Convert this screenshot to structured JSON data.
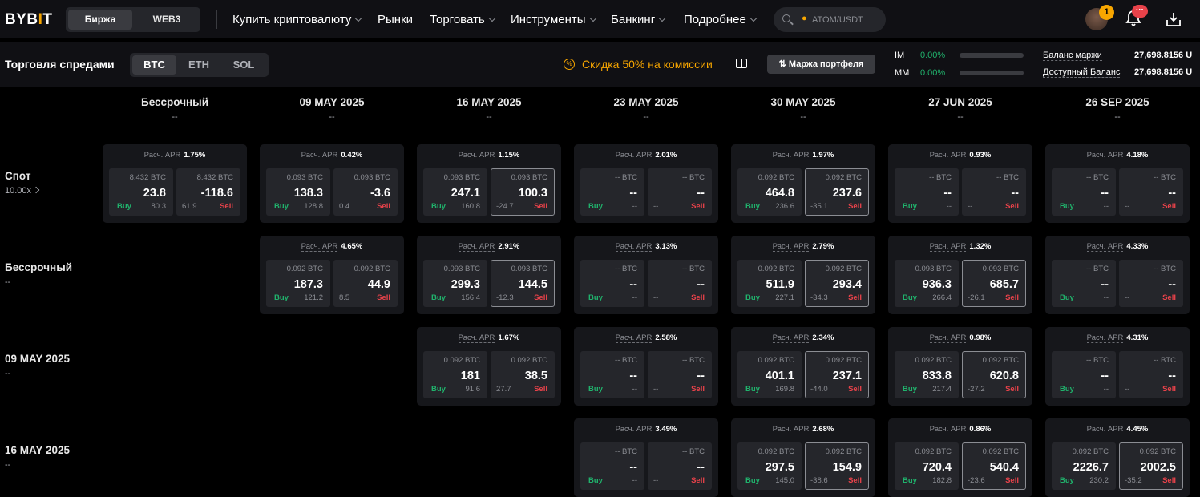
{
  "header": {
    "logo": {
      "pre": "BYB",
      "mid": "I",
      "post": "T"
    },
    "switch": {
      "exchange": "Биржа",
      "web3": "WEB3"
    },
    "nav": [
      "Купить криптовалюту",
      "Рынки",
      "Торговать",
      "Инструменты",
      "Банкинг",
      "Подробнее"
    ],
    "search_placeholder": "ATOM/USDT",
    "avatar_badge": "1",
    "bell_badge": "···"
  },
  "subbar": {
    "title": "Торговля спредами",
    "coins": [
      "BTC",
      "ETH",
      "SOL"
    ],
    "active_coin": "BTC",
    "promo": "Скидка 50% на комиссии",
    "portfolio_margin": "Маржа портфеля",
    "im_label": "IM",
    "im_value": "0.00%",
    "mm_label": "MM",
    "mm_value": "0.00%",
    "margin_balance_label": "Баланс маржи",
    "margin_balance_value": "27,698.8156 U",
    "available_label": "Доступный Баланс",
    "available_value": "27,698.8156 U"
  },
  "colors": {
    "accent": "#f7a600",
    "buy": "#20b26c",
    "sell": "#e8424a",
    "card": "#16171b",
    "cell": "#25262b"
  },
  "labels": {
    "apr": "Расч. APR",
    "buy": "Buy",
    "sell": "Sell",
    "unit": "BTC",
    "dash": "--"
  },
  "columns": [
    {
      "title": "Бессрочный",
      "sub": "--"
    },
    {
      "title": "09 MAY 2025",
      "sub": "--"
    },
    {
      "title": "16 MAY 2025",
      "sub": "--"
    },
    {
      "title": "23 MAY 2025",
      "sub": "--"
    },
    {
      "title": "30 MAY 2025",
      "sub": "--"
    },
    {
      "title": "27 JUN 2025",
      "sub": "--"
    },
    {
      "title": "26 SEP 2025",
      "sub": "--"
    }
  ],
  "rows": [
    {
      "title": "Спот",
      "sub": "10.00x",
      "sub_link": true
    },
    {
      "title": "Бессрочный",
      "sub": "--"
    },
    {
      "title": "09 MAY 2025",
      "sub": "--"
    },
    {
      "title": "16 MAY 2025",
      "sub": "--"
    }
  ],
  "cards": [
    [
      {
        "col": 0,
        "apr": "1.75%",
        "bq": "8.432 BTC",
        "bp": "23.8",
        "bs": "80.3",
        "sq": "8.432 BTC",
        "sp": "-118.6",
        "ss": "61.9",
        "sell_active": false
      },
      {
        "col": 1,
        "apr": "0.42%",
        "bq": "0.093 BTC",
        "bp": "138.3",
        "bs": "128.8",
        "sq": "0.093 BTC",
        "sp": "-3.6",
        "ss": "0.4",
        "sell_active": false
      },
      {
        "col": 2,
        "apr": "1.15%",
        "bq": "0.093 BTC",
        "bp": "247.1",
        "bs": "160.8",
        "sq": "0.093 BTC",
        "sp": "100.3",
        "ss": "-24.7",
        "sell_active": true
      },
      {
        "col": 3,
        "apr": "2.01%",
        "bq": "-- BTC",
        "bp": "--",
        "bs": "--",
        "sq": "-- BTC",
        "sp": "--",
        "ss": "--",
        "sell_active": false
      },
      {
        "col": 4,
        "apr": "1.97%",
        "bq": "0.092 BTC",
        "bp": "464.8",
        "bs": "236.6",
        "sq": "0.092 BTC",
        "sp": "237.6",
        "ss": "-35.1",
        "sell_active": true
      },
      {
        "col": 5,
        "apr": "0.93%",
        "bq": "-- BTC",
        "bp": "--",
        "bs": "--",
        "sq": "-- BTC",
        "sp": "--",
        "ss": "--",
        "sell_active": false
      },
      {
        "col": 6,
        "apr": "4.18%",
        "bq": "-- BTC",
        "bp": "--",
        "bs": "--",
        "sq": "-- BTC",
        "sp": "--",
        "ss": "--",
        "sell_active": false
      }
    ],
    [
      {
        "col": 1,
        "apr": "4.65%",
        "bq": "0.092 BTC",
        "bp": "187.3",
        "bs": "121.2",
        "sq": "0.092 BTC",
        "sp": "44.9",
        "ss": "8.5",
        "sell_active": false
      },
      {
        "col": 2,
        "apr": "2.91%",
        "bq": "0.093 BTC",
        "bp": "299.3",
        "bs": "156.4",
        "sq": "0.093 BTC",
        "sp": "144.5",
        "ss": "-12.3",
        "sell_active": true
      },
      {
        "col": 3,
        "apr": "3.13%",
        "bq": "-- BTC",
        "bp": "--",
        "bs": "--",
        "sq": "-- BTC",
        "sp": "--",
        "ss": "--",
        "sell_active": false
      },
      {
        "col": 4,
        "apr": "2.79%",
        "bq": "0.092 BTC",
        "bp": "511.9",
        "bs": "227.1",
        "sq": "0.092 BTC",
        "sp": "293.4",
        "ss": "-34.3",
        "sell_active": true
      },
      {
        "col": 5,
        "apr": "1.32%",
        "bq": "0.093 BTC",
        "bp": "936.3",
        "bs": "266.4",
        "sq": "0.093 BTC",
        "sp": "685.7",
        "ss": "-26.1",
        "sell_active": true
      },
      {
        "col": 6,
        "apr": "4.33%",
        "bq": "-- BTC",
        "bp": "--",
        "bs": "--",
        "sq": "-- BTC",
        "sp": "--",
        "ss": "--",
        "sell_active": false
      }
    ],
    [
      {
        "col": 2,
        "apr": "1.67%",
        "bq": "0.092 BTC",
        "bp": "181",
        "bs": "91.6",
        "sq": "0.092 BTC",
        "sp": "38.5",
        "ss": "27.7",
        "sell_active": false
      },
      {
        "col": 3,
        "apr": "2.58%",
        "bq": "-- BTC",
        "bp": "--",
        "bs": "--",
        "sq": "-- BTC",
        "sp": "--",
        "ss": "--",
        "sell_active": false
      },
      {
        "col": 4,
        "apr": "2.34%",
        "bq": "0.092 BTC",
        "bp": "401.1",
        "bs": "169.8",
        "sq": "0.092 BTC",
        "sp": "237.1",
        "ss": "-44.0",
        "sell_active": true
      },
      {
        "col": 5,
        "apr": "0.98%",
        "bq": "0.092 BTC",
        "bp": "833.8",
        "bs": "217.4",
        "sq": "0.092 BTC",
        "sp": "620.8",
        "ss": "-27.2",
        "sell_active": true
      },
      {
        "col": 6,
        "apr": "4.31%",
        "bq": "-- BTC",
        "bp": "--",
        "bs": "--",
        "sq": "-- BTC",
        "sp": "--",
        "ss": "--",
        "sell_active": false
      }
    ],
    [
      {
        "col": 3,
        "apr": "3.49%",
        "bq": "-- BTC",
        "bp": "--",
        "bs": "--",
        "sq": "-- BTC",
        "sp": "--",
        "ss": "--",
        "sell_active": false
      },
      {
        "col": 4,
        "apr": "2.68%",
        "bq": "0.092 BTC",
        "bp": "297.5",
        "bs": "145.0",
        "sq": "0.092 BTC",
        "sp": "154.9",
        "ss": "-38.6",
        "sell_active": true
      },
      {
        "col": 5,
        "apr": "0.86%",
        "bq": "0.092 BTC",
        "bp": "720.4",
        "bs": "182.8",
        "sq": "0.092 BTC",
        "sp": "540.4",
        "ss": "-23.6",
        "sell_active": true
      },
      {
        "col": 6,
        "apr": "4.45%",
        "bq": "0.092 BTC",
        "bp": "2226.7",
        "bs": "230.2",
        "sq": "0.092 BTC",
        "sp": "2002.5",
        "ss": "-35.2",
        "sell_active": true
      }
    ]
  ]
}
